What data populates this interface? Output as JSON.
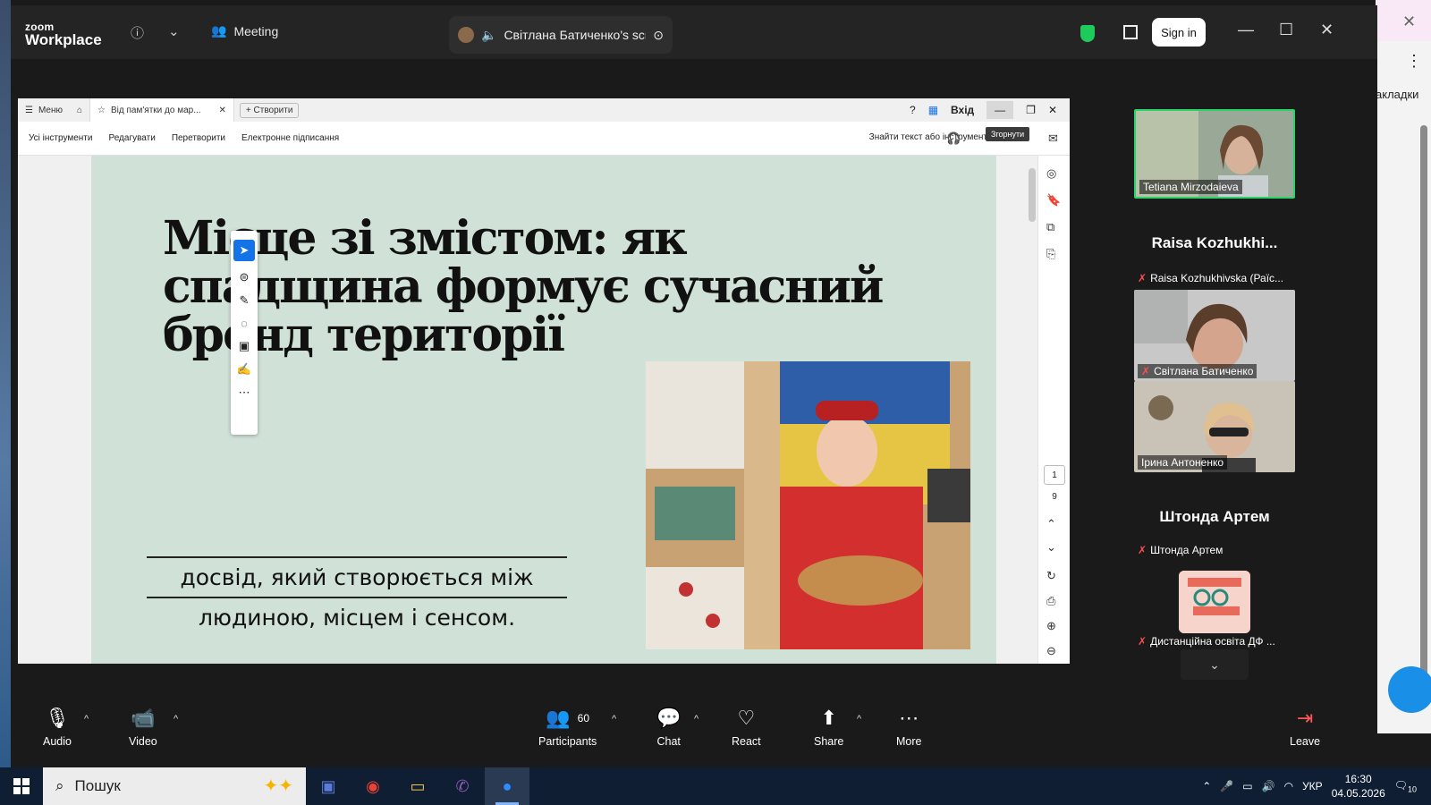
{
  "app": {
    "logo_line1": "zoom",
    "logo_line2": "Workplace",
    "meeting_label": "Meeting",
    "sharing_label": "Світлана Батиченко's screen",
    "sign_in": "Sign in"
  },
  "pdf": {
    "menu": "Меню",
    "tab_title": "Від пам'ятки до мар...",
    "create": "Створити",
    "login": "Вхід",
    "toolbar": [
      "Усі інструменти",
      "Редагувати",
      "Перетворити",
      "Електронне підписання"
    ],
    "search": "Знайти текст або інструменти",
    "tooltip": "Згорнути",
    "page_current": "1",
    "page_total": "9"
  },
  "slide": {
    "title_line1": "Місце зі змістом: як",
    "title_line2": "спадщина формує сучасний",
    "title_line3": "бренд території",
    "subtitle_line1": "досвід, який створюється між",
    "subtitle_line2": "людиною, місцем і сенсом."
  },
  "participants": {
    "active_speaker": "Tetiana Mirzodaieva",
    "header1": "Raisa Kozhukhi...",
    "strip1": "Raisa Kozhukhivska (Раїс...",
    "tile2": "Світлана Батиченко",
    "tile3": "Ірина Антоненко",
    "header2": "Штонда Артем",
    "strip2": "Штонда Артем",
    "strip3": "Дистанційна освіта ДФ ..."
  },
  "controls": {
    "audio": "Audio",
    "video": "Video",
    "participants": "Participants",
    "participants_count": "60",
    "chat": "Chat",
    "react": "React",
    "share": "Share",
    "more": "More",
    "leave": "Leave"
  },
  "taskbar": {
    "search": "Пошук",
    "lang": "УКР",
    "time": "16:30",
    "date": "04.05.2026",
    "notif": "10"
  },
  "browser": {
    "bookmarks": "акладки"
  },
  "colors": {
    "zoom_bg": "#1a1a1a",
    "slide_bg": "#d0e1d7",
    "active_border": "#2ad46a",
    "mic_off": "#ff4d4d"
  }
}
